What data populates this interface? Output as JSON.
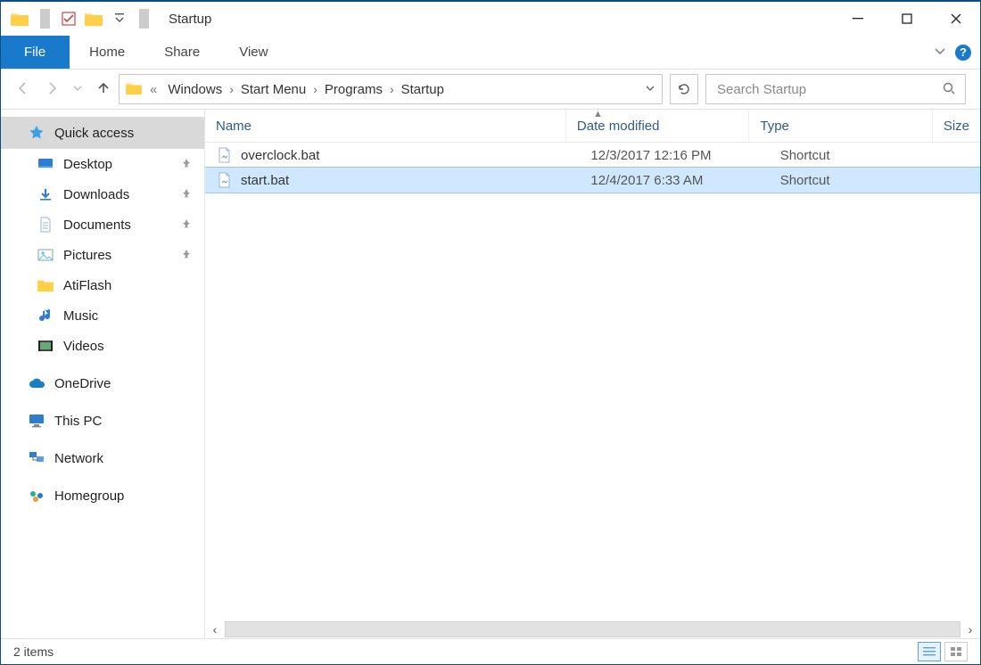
{
  "window": {
    "title": "Startup"
  },
  "tabs": {
    "file": "File",
    "home": "Home",
    "share": "Share",
    "view": "View"
  },
  "breadcrumb": {
    "items": [
      "Windows",
      "Start Menu",
      "Programs",
      "Startup"
    ]
  },
  "search": {
    "placeholder": "Search Startup"
  },
  "nav": {
    "quick_access": "Quick access",
    "pinned": [
      {
        "label": "Desktop",
        "icon": "desktop"
      },
      {
        "label": "Downloads",
        "icon": "download"
      },
      {
        "label": "Documents",
        "icon": "document"
      },
      {
        "label": "Pictures",
        "icon": "pictures"
      }
    ],
    "recent": [
      {
        "label": "AtiFlash",
        "icon": "folder"
      },
      {
        "label": "Music",
        "icon": "music"
      },
      {
        "label": "Videos",
        "icon": "video"
      }
    ],
    "roots": [
      {
        "label": "OneDrive",
        "icon": "onedrive"
      },
      {
        "label": "This PC",
        "icon": "pc"
      },
      {
        "label": "Network",
        "icon": "network"
      },
      {
        "label": "Homegroup",
        "icon": "homegroup"
      }
    ]
  },
  "columns": {
    "name": "Name",
    "date": "Date modified",
    "type": "Type",
    "size": "Size"
  },
  "files": [
    {
      "name": "overclock.bat",
      "date": "12/3/2017 12:16 PM",
      "type": "Shortcut",
      "selected": false
    },
    {
      "name": "start.bat",
      "date": "12/4/2017 6:33 AM",
      "type": "Shortcut",
      "selected": true
    }
  ],
  "status": {
    "text": "2 items"
  }
}
